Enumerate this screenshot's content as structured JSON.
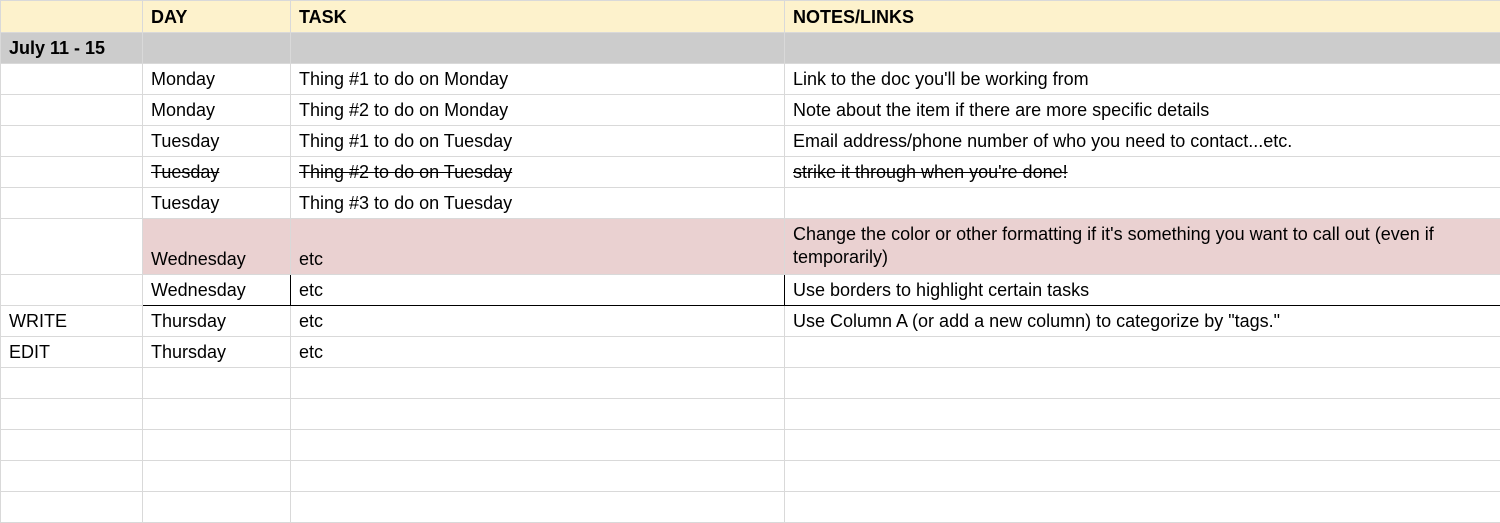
{
  "headers": {
    "col1": "",
    "col2": "DAY",
    "col3": "TASK",
    "col4": "NOTES/LINKS"
  },
  "week_label": "July 11 - 15",
  "rows": [
    {
      "c1": "",
      "c2": "Monday",
      "c3": "Thing #1 to do on Monday",
      "c4": "Link to the doc you'll be working from"
    },
    {
      "c1": "",
      "c2": "Monday",
      "c3": "Thing #2 to do on Monday",
      "c4": "Note about the item if there are more specific details"
    },
    {
      "c1": "",
      "c2": "Tuesday",
      "c3": "Thing #1 to do on Tuesday",
      "c4": "Email address/phone number of who you need to contact...etc."
    },
    {
      "c1": "",
      "c2": "Tuesday",
      "c3": "Thing #2 to do on Tuesday",
      "c4": "strike it through when you're done!"
    },
    {
      "c1": "",
      "c2": "Tuesday",
      "c3": "Thing #3 to do on Tuesday",
      "c4": ""
    },
    {
      "c1": "",
      "c2": "Wednesday",
      "c3": "etc",
      "c4": "Change the color or other formatting if it's something you want to call out (even if temporarily)"
    },
    {
      "c1": "",
      "c2": "Wednesday",
      "c3": "etc",
      "c4": "Use borders to highlight certain tasks"
    },
    {
      "c1": "WRITE",
      "c2": "Thursday",
      "c3": "etc",
      "c4": "Use Column A (or add a new column) to categorize by \"tags.\""
    },
    {
      "c1": "EDIT",
      "c2": "Thursday",
      "c3": "etc",
      "c4": ""
    }
  ]
}
